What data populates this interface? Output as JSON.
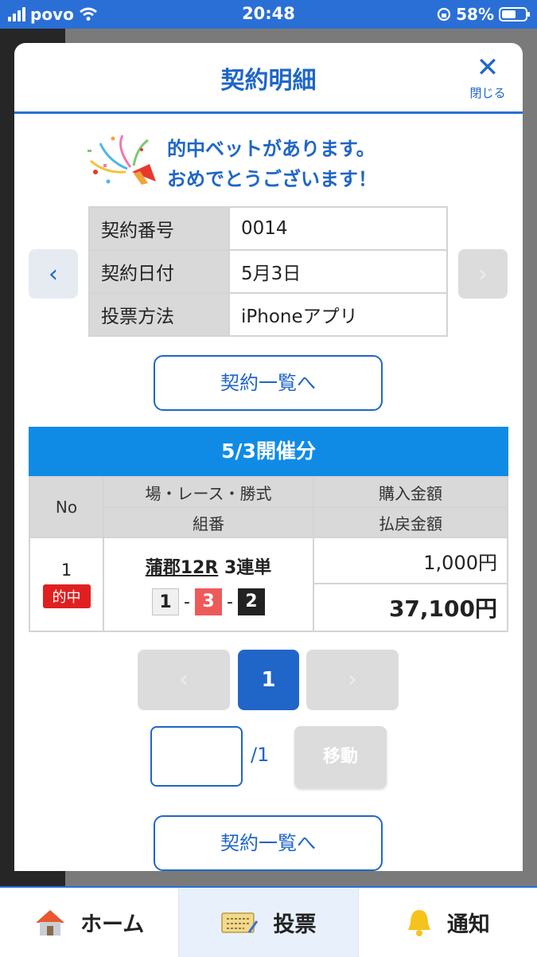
{
  "status_bar": {
    "carrier": "povo",
    "time": "20:48",
    "battery": "58%"
  },
  "modal": {
    "title": "契約明細",
    "close_label": "閉じる",
    "congrats_line1": "的中ベットがあります。",
    "congrats_line2": "おめでとうございます！",
    "info": [
      {
        "label": "契約番号",
        "value": "0014"
      },
      {
        "label": "契約日付",
        "value": "5月3日"
      },
      {
        "label": "投票方法",
        "value": "iPhoneアプリ"
      }
    ],
    "list_button": "契約一覧へ",
    "date_header": "5/3開催分",
    "bets_table": {
      "header_no": "No",
      "header_race": "場・レース・勝式",
      "header_combo": "組番",
      "header_purchase": "購入金額",
      "header_payout": "払戻金額",
      "rows": [
        {
          "no": "1",
          "badge": "的中",
          "race": "蒲郡12R",
          "bet_type": "3連単",
          "combo": [
            "1",
            "3",
            "2"
          ],
          "separator": "-",
          "purchase": "1,000円",
          "payout": "37,100円"
        }
      ]
    },
    "pagination": {
      "prev": "‹",
      "current": "1",
      "next": "›",
      "total": "/1",
      "move_label": "移動",
      "input_value": ""
    },
    "list_button_bottom": "契約一覧へ"
  },
  "tabbar": [
    {
      "label": "ホーム",
      "icon": "home-icon"
    },
    {
      "label": "投票",
      "icon": "ticket-icon"
    },
    {
      "label": "通知",
      "icon": "bell-icon"
    }
  ],
  "colors": {
    "accent": "#1f66c8",
    "header_bar": "#0f8be6",
    "win": "#e02020"
  }
}
